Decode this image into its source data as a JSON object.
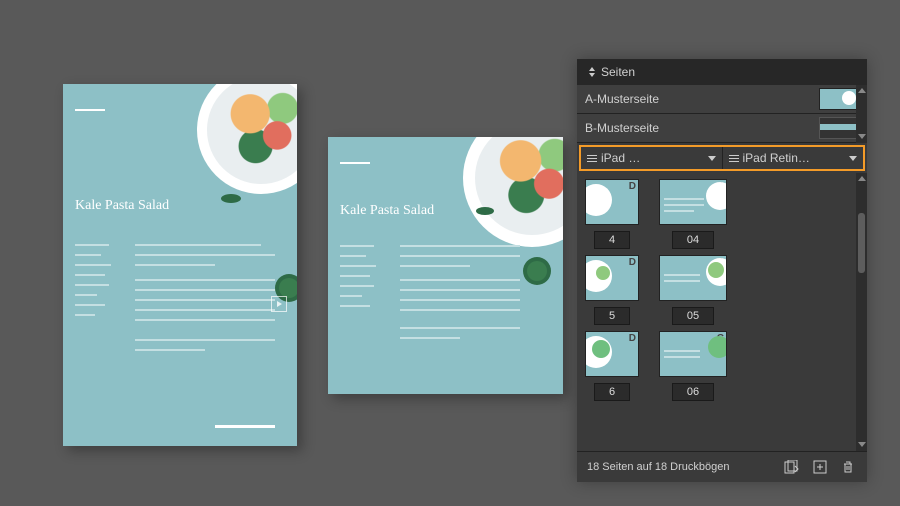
{
  "doc": {
    "title": "Kale Pasta Salad"
  },
  "panel": {
    "tab": "Seiten",
    "masters": [
      "A-Musterseite",
      "B-Musterseite"
    ],
    "layouts": [
      "iPad …",
      "iPad Retin…"
    ],
    "pages_left": [
      "4",
      "5",
      "6"
    ],
    "pages_right": [
      "04",
      "05",
      "06"
    ],
    "marker_left": "D",
    "marker_right": "C",
    "footer": "18 Seiten auf 18 Druckbögen"
  }
}
